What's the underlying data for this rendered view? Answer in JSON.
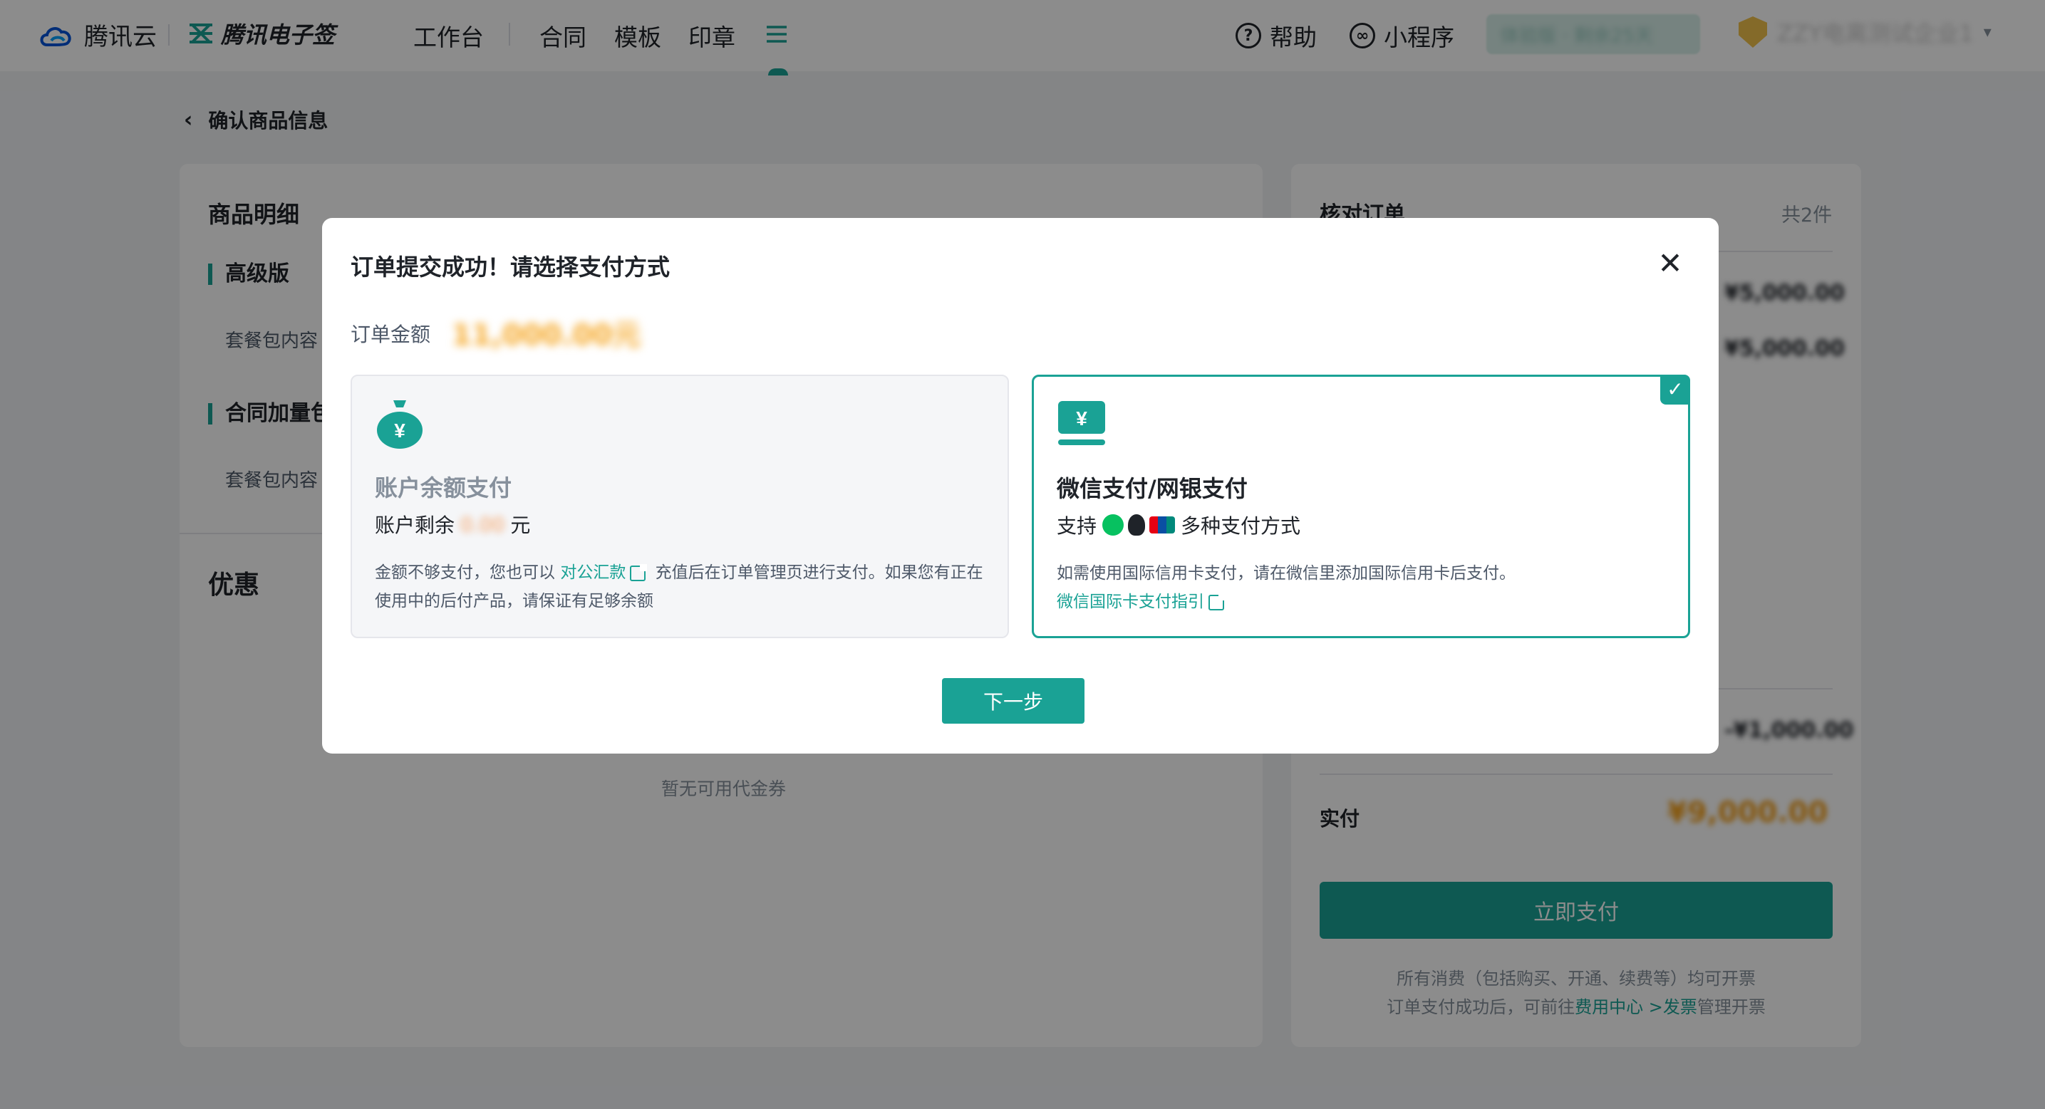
{
  "topbar": {
    "brand_cloud": "腾讯云",
    "brand_esign": "腾讯电子签",
    "nav": [
      "工作台",
      "合同",
      "模板",
      "印章"
    ],
    "help": "帮助",
    "miniprogram": "小程序",
    "trial_pill": "体验版 · 剩余25天",
    "org_name": "ZZY电离测试企业1"
  },
  "page": {
    "back_title": "确认商品信息",
    "left": {
      "section_title": "商品明细",
      "items": [
        {
          "name": "高级版",
          "content_label": "套餐包内容"
        },
        {
          "name": "合同加量包",
          "content_label": "套餐包内容"
        }
      ],
      "coupon_title": "优惠",
      "no_coupon": "暂无可用代金券"
    },
    "right": {
      "title": "核对订单",
      "count": "共2件",
      "prices": [
        "¥5,000.00",
        "¥5,000.00"
      ],
      "discount": "-¥1,000.00",
      "paid_label": "实付",
      "paid_amount": "¥9,000.00",
      "pay_now": "立即支付",
      "note_line1": "所有消费（包括购买、开通、续费等）均可开票",
      "note_line2_prefix": "订单支付成功后，可前往",
      "note_link1": "费用中心",
      "note_sep": " >",
      "note_link2": "发票",
      "note_line2_suffix": "管理开票"
    }
  },
  "modal": {
    "title": "订单提交成功！请选择支付方式",
    "amount_label": "订单金额",
    "amount_value": "11,000.00元",
    "option_balance": {
      "title": "账户余额支付",
      "balance_prefix": "账户剩余",
      "balance_value": "0.00",
      "balance_suffix": "元",
      "desc_prefix": "金额不够支付，您也可以",
      "desc_link": "对公汇款",
      "desc_suffix": "充值后在订单管理页进行支付。如果您有正在使用中的后付产品，请保证有足够余额"
    },
    "option_online": {
      "title": "微信支付/网银支付",
      "support_prefix": "支持",
      "support_suffix": "多种支付方式",
      "desc": "如需使用国际信用卡支付，请在微信里添加国际信用卡后支付。",
      "link": "微信国际卡支付指引",
      "selected": true
    },
    "next_button": "下一步",
    "close_icon": "close-icon"
  },
  "colors": {
    "accent": "#1aa295",
    "amount": "#f5a623"
  }
}
